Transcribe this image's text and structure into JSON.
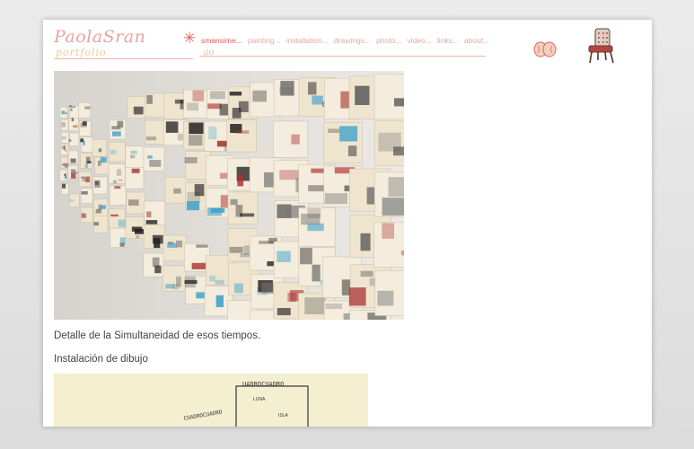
{
  "header": {
    "logo_text": "PaolaSran",
    "logo_sub": "portfolio",
    "go_label": "go",
    "nav": [
      {
        "label": "smansime..."
      },
      {
        "label": "painting..."
      },
      {
        "label": "installation..."
      },
      {
        "label": "drawings..."
      },
      {
        "label": "photo..."
      },
      {
        "label": "video..."
      },
      {
        "label": "links..."
      },
      {
        "label": "about..."
      }
    ]
  },
  "content": {
    "caption": "Detalle de la Simultaneidad de esos tiempos.",
    "subtitle": "Instalación de dibujo",
    "second_image_text": "UADROCUADRO"
  },
  "colors": {
    "accent": "#e05a53",
    "nav_text": "#e6a8a1",
    "logo": "#e8a4a0",
    "paper": "#f5efd2"
  }
}
